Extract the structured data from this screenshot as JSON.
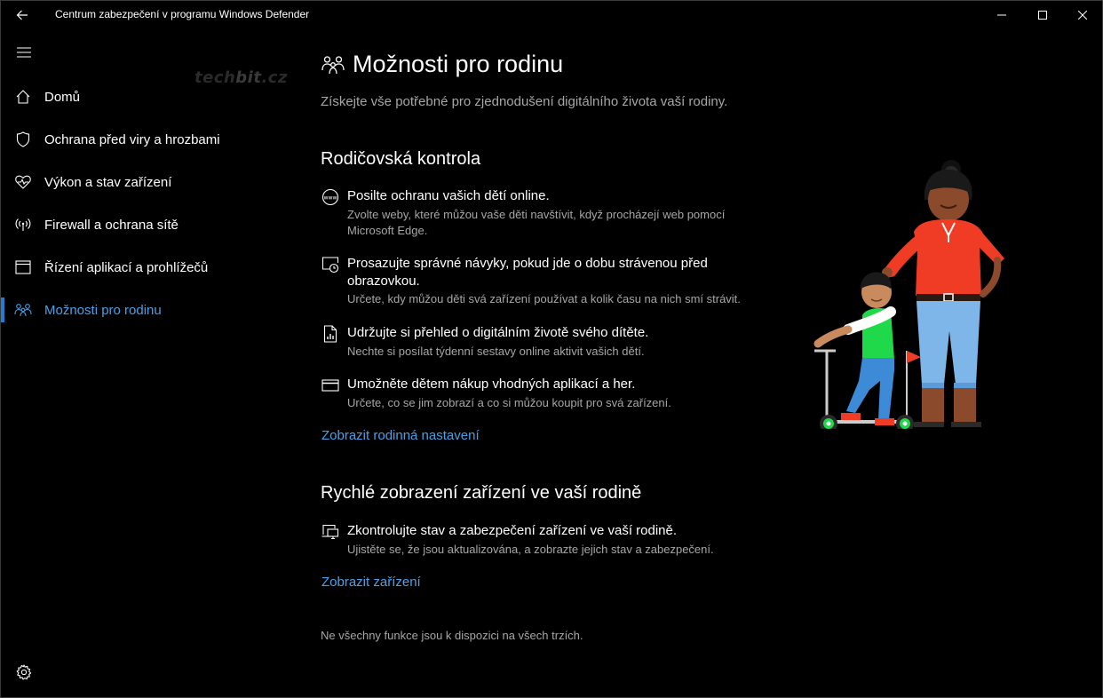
{
  "window": {
    "title": "Centrum zabezpečení v programu Windows Defender"
  },
  "watermark": {
    "part1": "tech",
    "part2": "bit",
    "part3": ".cz"
  },
  "sidebar": {
    "items": [
      {
        "label": "Domů",
        "icon": "home-icon"
      },
      {
        "label": "Ochrana před viry a hrozbami",
        "icon": "shield-icon"
      },
      {
        "label": "Výkon a stav zařízení",
        "icon": "heart-pulse-icon"
      },
      {
        "label": "Firewall a ochrana sítě",
        "icon": "wireless-icon"
      },
      {
        "label": "Řízení aplikací a prohlížečů",
        "icon": "app-browser-icon"
      },
      {
        "label": "Možnosti pro rodinu",
        "icon": "family-icon",
        "active": true
      }
    ]
  },
  "page": {
    "title": "Možnosti pro rodinu",
    "subtitle": "Získejte vše potřebné pro zjednodušení digitálního života vaší rodiny."
  },
  "parental": {
    "heading": "Rodičovská kontrola",
    "features": [
      {
        "title": "Posilte ochranu vašich dětí online.",
        "desc": "Zvolte weby, které můžou vaše děti navštívit, když procházejí web pomocí Microsoft Edge.",
        "icon": "web-icon"
      },
      {
        "title": "Prosazujte správné návyky, pokud jde o dobu strávenou před obrazovkou.",
        "desc": "Určete, kdy můžou děti svá zařízení používat a kolik času na nich smí strávit.",
        "icon": "screen-time-icon"
      },
      {
        "title": "Udržujte si přehled o digitálním životě svého dítěte.",
        "desc": "Nechte si posílat týdenní sestavy online aktivit vašich dětí.",
        "icon": "report-icon"
      },
      {
        "title": "Umožněte dětem nákup vhodných aplikací a her.",
        "desc": "Určete, co se jim zobrazí a co si můžou koupit pro svá zařízení.",
        "icon": "card-icon"
      }
    ],
    "link": "Zobrazit rodinná nastavení"
  },
  "devices": {
    "heading": "Rychlé zobrazení zařízení ve vaší rodině",
    "feature": {
      "title": "Zkontrolujte stav a zabezpečení zařízení ve vaší rodině.",
      "desc": "Ujistěte se, že jsou aktualizována, a zobrazte jejich stav a zabezpečení.",
      "icon": "devices-icon"
    },
    "link": "Zobrazit zařízení"
  },
  "footnote": "Ne všechny funkce jsou k dispozici na všech trzích.",
  "colors": {
    "accent": "#4aa0e6",
    "active_bar": "#1e7fd0",
    "background": "#000000",
    "secondary_text": "#a6a6a6"
  }
}
